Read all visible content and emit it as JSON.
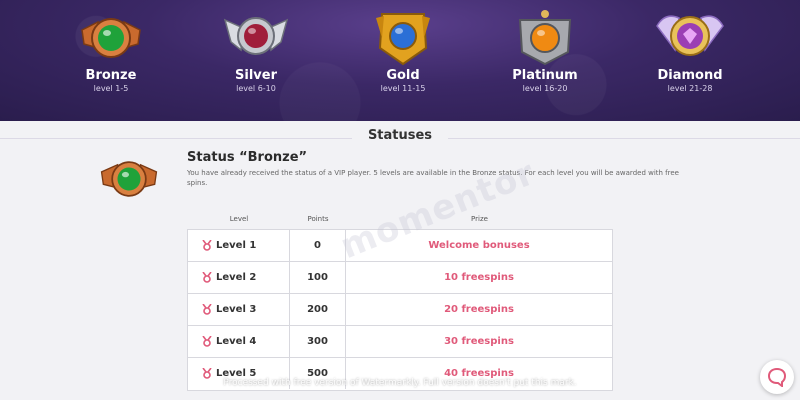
{
  "tiers": [
    {
      "name": "Bronze",
      "levels": "level 1-5",
      "gem_color": "#1fa23a",
      "frame_color": "#c96a2e"
    },
    {
      "name": "Silver",
      "levels": "level 6-10",
      "gem_color": "#a01e3a",
      "frame_color": "#b8bcc4"
    },
    {
      "name": "Gold",
      "levels": "level 11-15",
      "gem_color": "#2b6fd6",
      "frame_color": "#e2a21f"
    },
    {
      "name": "Platinum",
      "levels": "level 16-20",
      "gem_color": "#f08a12",
      "frame_color": "#a7a9ae"
    },
    {
      "name": "Diamond",
      "levels": "level 21-28",
      "gem_color": "#c65bd9",
      "frame_color": "#e9c25a"
    }
  ],
  "statuses": {
    "title": "Statuses",
    "status_title": "Status “Bronze”",
    "description": "You have already received the status of a VIP player. 5 levels are available in the Bronze status. For each level you will be awarded with free spins."
  },
  "table": {
    "headers": {
      "level": "Level",
      "points": "Points",
      "prize": "Prize"
    },
    "rows": [
      {
        "level": "Level 1",
        "points": "0",
        "prize": "Welcome bonuses"
      },
      {
        "level": "Level 2",
        "points": "100",
        "prize": "10 freespins"
      },
      {
        "level": "Level 3",
        "points": "200",
        "prize": "20 freespins"
      },
      {
        "level": "Level 4",
        "points": "300",
        "prize": "30 freespins"
      },
      {
        "level": "Level 5",
        "points": "500",
        "prize": "40 freespins"
      }
    ]
  },
  "watermark": "momentor",
  "footer_note": "Processed with free version of Watermarkly. Full version doesn't put this mark.",
  "colors": {
    "accent": "#e05a7a",
    "banner": "#3b2866"
  }
}
